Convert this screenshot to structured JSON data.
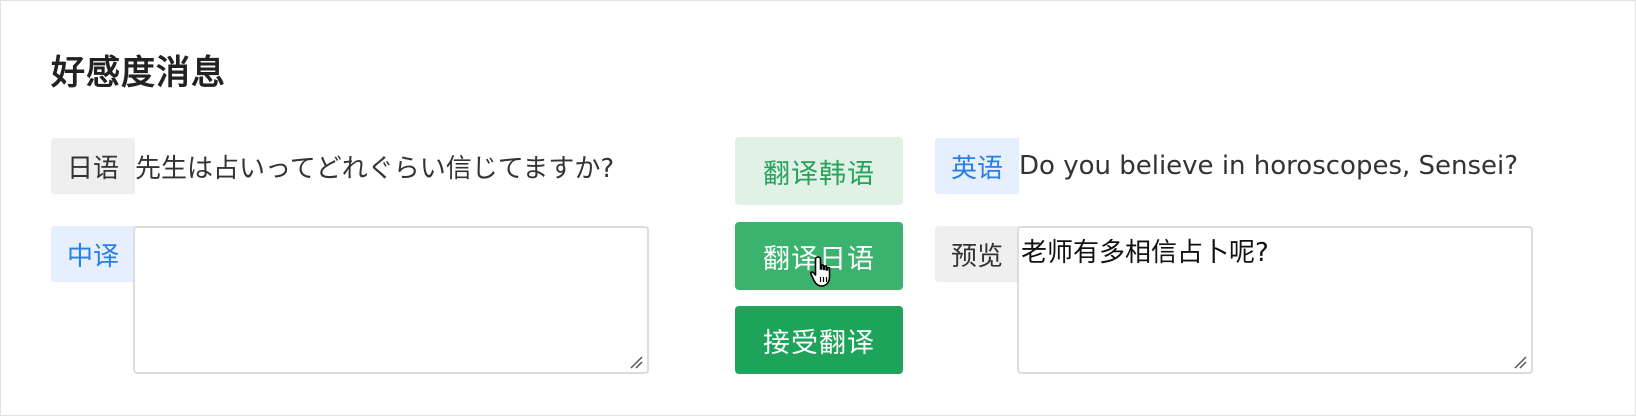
{
  "section": {
    "title": "好感度消息"
  },
  "japanese": {
    "tag": "日语",
    "text": "先生は占いってどれぐらい信じてますか?"
  },
  "chinese": {
    "tag": "中译",
    "value": ""
  },
  "english": {
    "tag": "英语",
    "text": "Do you believe in horoscopes, Sensei?"
  },
  "preview": {
    "tag": "预览",
    "value": "老师有多相信占卜呢?"
  },
  "buttons": {
    "translate_korean": "翻译韩语",
    "translate_japanese": "翻译日语",
    "accept_translation": "接受翻译"
  },
  "colors": {
    "accent_green": "#1ea35a",
    "accent_blue": "#2a7ee6"
  }
}
